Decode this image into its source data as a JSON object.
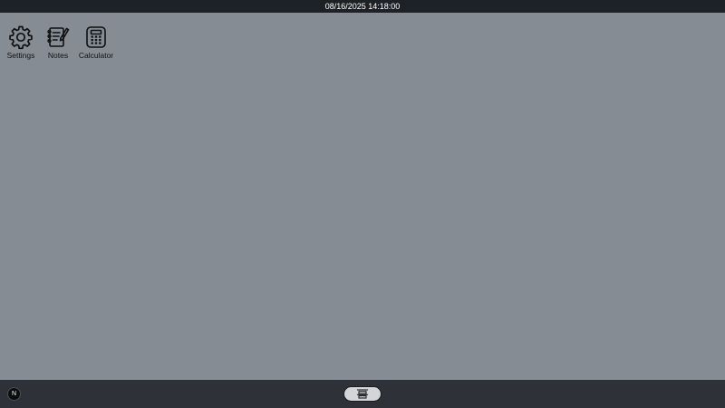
{
  "topbar": {
    "datetime": "08/16/2025 14:18:00"
  },
  "desktop": {
    "icons": [
      {
        "label": "Settings",
        "icon": "gear-icon"
      },
      {
        "label": "Notes",
        "icon": "notepad-icon"
      },
      {
        "label": "Calculator",
        "icon": "calculator-icon"
      }
    ]
  },
  "taskbar": {
    "start_glyph": "N",
    "launcher_icon": "app-launcher-icon"
  },
  "colors": {
    "topbar_bg": "#1e2126",
    "desktop_bg": "#868c93",
    "taskbar_bg": "#2e3238",
    "launcher_bg": "#d3d5d8"
  }
}
